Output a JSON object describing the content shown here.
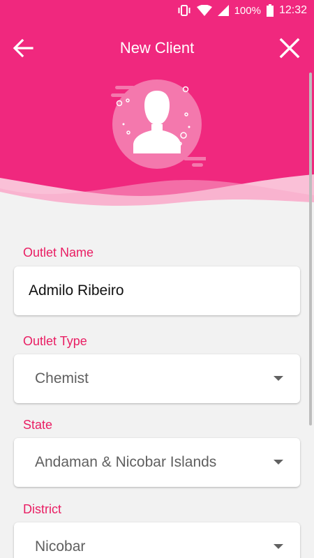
{
  "status_bar": {
    "battery_percent": "100%",
    "time": "12:32",
    "icons": [
      "vibrate-icon",
      "wifi-icon",
      "signal-icon",
      "battery-icon"
    ]
  },
  "toolbar": {
    "title": "New Client",
    "back_icon": "arrow-left-icon",
    "close_icon": "close-icon"
  },
  "colors": {
    "header": "#f0287e",
    "label": "#e91e63",
    "background": "#f2f2f2"
  },
  "form": {
    "outlet_name": {
      "label": "Outlet Name",
      "value": "Admilo Ribeiro"
    },
    "outlet_type": {
      "label": "Outlet Type",
      "value": "Chemist"
    },
    "state": {
      "label": "State",
      "value": "Andaman & Nicobar Islands"
    },
    "district": {
      "label": "District",
      "value": "Nicobar"
    }
  }
}
